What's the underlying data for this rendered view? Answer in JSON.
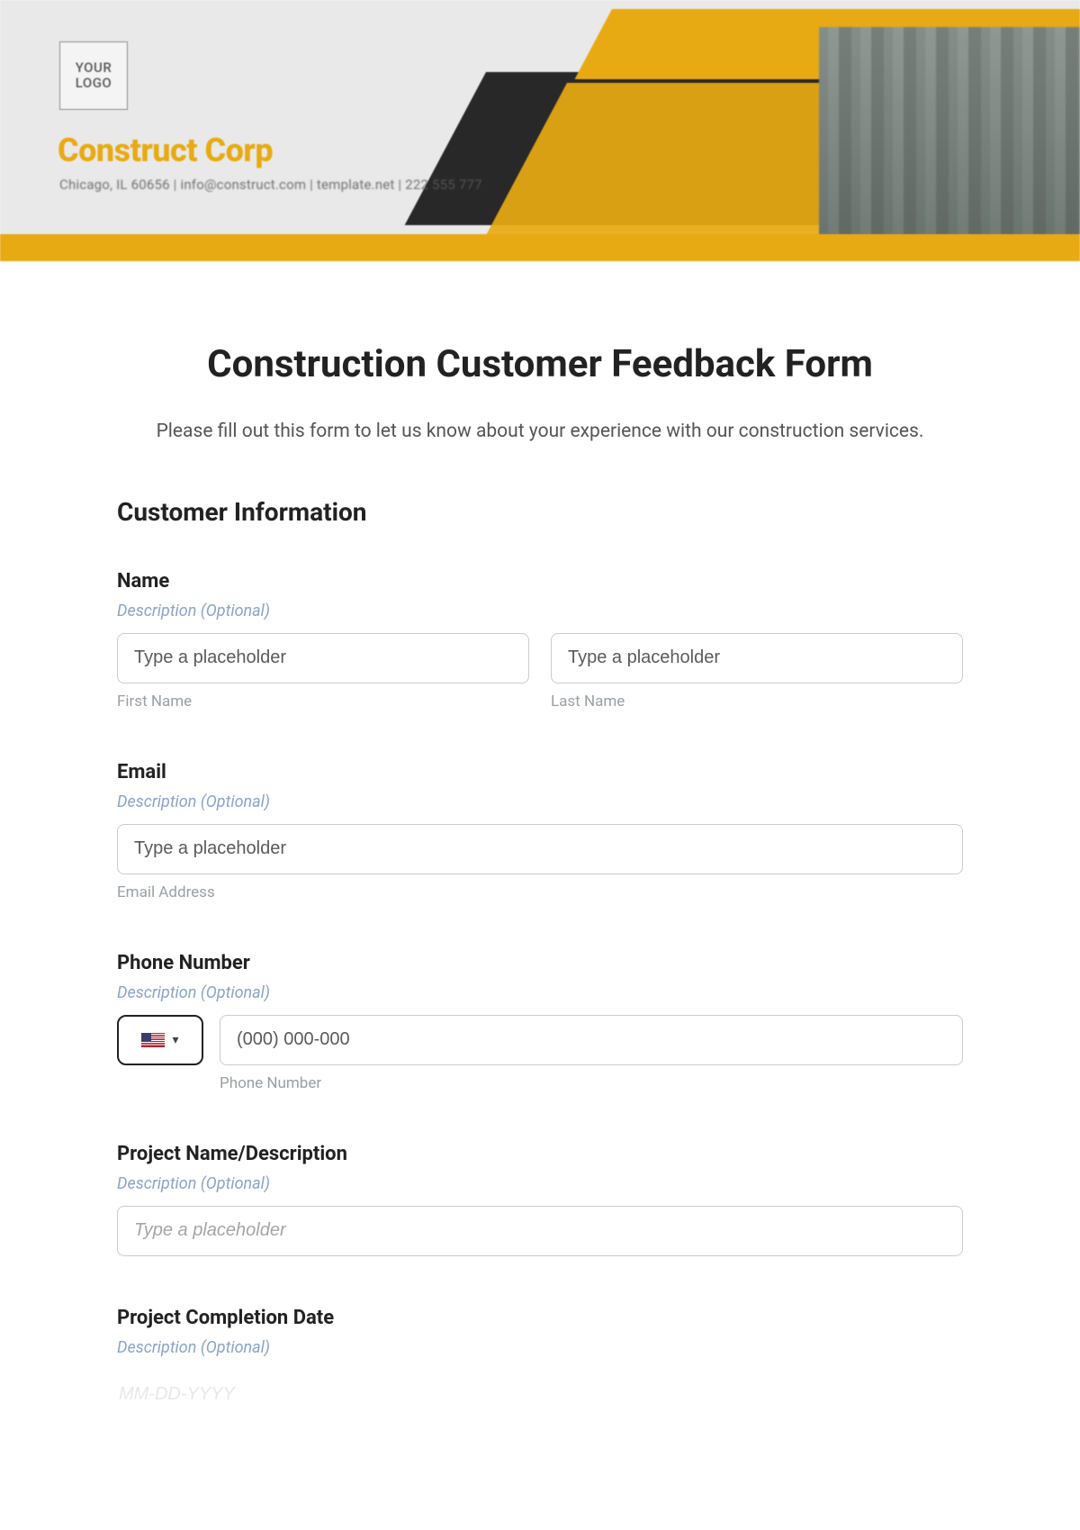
{
  "header": {
    "logo_text": "YOUR\nLOGO",
    "company_name": "Construct Corp",
    "company_sub": "Chicago, IL 60656 | info@construct.com | template.net | 222 555 777"
  },
  "form": {
    "title": "Construction Customer Feedback Form",
    "description": "Please fill out this form to let us know about your experience with our construction services.",
    "section_customer": "Customer Information",
    "hint_optional": "Description (Optional)",
    "name": {
      "label": "Name",
      "first_placeholder": "Type a placeholder",
      "first_sub": "First Name",
      "last_placeholder": "Type a placeholder",
      "last_sub": "Last Name"
    },
    "email": {
      "label": "Email",
      "placeholder": "Type a placeholder",
      "sub": "Email Address"
    },
    "phone": {
      "label": "Phone Number",
      "placeholder": "(000) 000-000",
      "sub": "Phone Number"
    },
    "project": {
      "label": "Project Name/Description",
      "placeholder": "Type a placeholder"
    },
    "completion": {
      "label": "Project Completion Date",
      "placeholder": "MM-DD-YYYY"
    }
  }
}
